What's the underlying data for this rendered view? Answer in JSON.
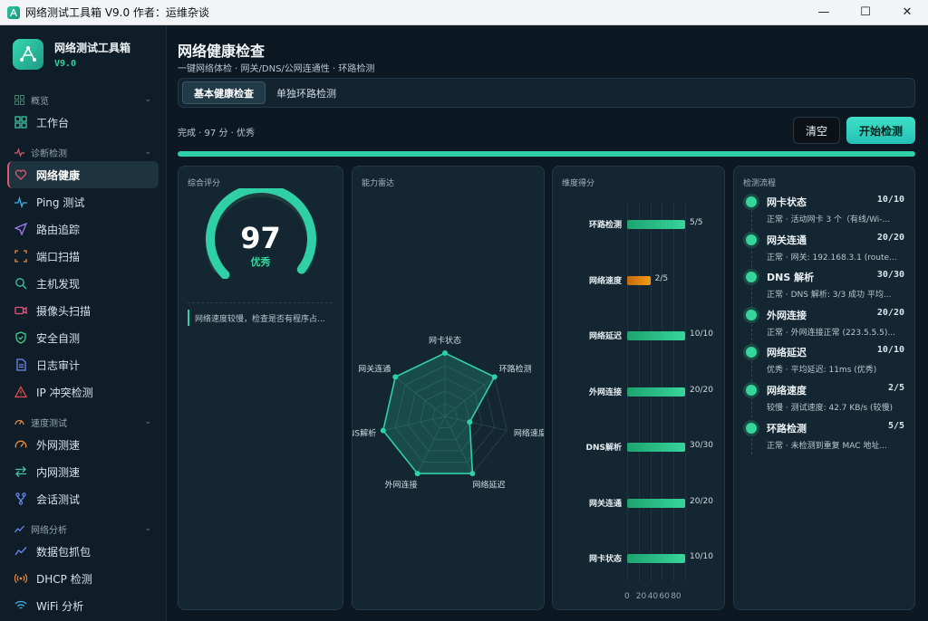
{
  "window": {
    "title": "网络测试工具箱 V9.0  作者：运维杂谈",
    "minimize": "—",
    "maximize": "☐",
    "close": "✕"
  },
  "brand": {
    "name": "网络测试工具箱",
    "version": "V9.0"
  },
  "sidebar": {
    "groups": [
      {
        "label": "概览",
        "items": [
          {
            "label": "工作台",
            "icon": "grid-icon"
          }
        ]
      },
      {
        "label": "诊断检测",
        "items": [
          {
            "label": "网络健康",
            "icon": "heart-icon",
            "active": true
          },
          {
            "label": "Ping 测试",
            "icon": "pulse-icon"
          },
          {
            "label": "路由追踪",
            "icon": "send-icon"
          },
          {
            "label": "端口扫描",
            "icon": "scan-icon"
          },
          {
            "label": "主机发现",
            "icon": "search-icon"
          },
          {
            "label": "摄像头扫描",
            "icon": "camera-icon"
          },
          {
            "label": "安全自测",
            "icon": "shield-icon"
          },
          {
            "label": "日志审计",
            "icon": "document-icon"
          },
          {
            "label": "IP 冲突检测",
            "icon": "warning-icon"
          }
        ]
      },
      {
        "label": "速度测试",
        "items": [
          {
            "label": "外网测速",
            "icon": "speedometer-icon"
          },
          {
            "label": "内网测速",
            "icon": "transfer-icon"
          },
          {
            "label": "会话测试",
            "icon": "fork-icon"
          }
        ]
      },
      {
        "label": "网络分析",
        "items": [
          {
            "label": "数据包抓包",
            "icon": "chart-line-icon"
          },
          {
            "label": "DHCP 检测",
            "icon": "broadcast-icon"
          },
          {
            "label": "WiFi 分析",
            "icon": "wifi-icon"
          }
        ]
      }
    ]
  },
  "page": {
    "title": "网络健康检查",
    "subtitle": "一键网络体检 · 网关/DNS/公网连通性 · 环路检测",
    "tabs": [
      "基本健康检查",
      "单独环路检测"
    ],
    "status": "完成 · 97 分 · 优秀",
    "clear_button": "清空",
    "start_button": "开始检测",
    "progress": 1.0
  },
  "score_card": {
    "title": "综合评分",
    "score": 97,
    "max": 100,
    "grade": "优秀",
    "tip": "网络速度较慢，检查是否有程序占..."
  },
  "radar_card": {
    "title": "能力雷达",
    "labels": [
      "网卡状态",
      "环路检测",
      "网络速度",
      "网络延迟",
      "外网连接",
      "DNS解析",
      "网关连通"
    ]
  },
  "dim_card": {
    "title": "维度得分",
    "axis_ticks": [
      "0",
      "20",
      "40",
      "60",
      "80"
    ]
  },
  "flow_card": {
    "title": "检测流程",
    "steps": [
      {
        "name": "网卡状态",
        "score": "10/10",
        "desc": "正常 · 活动网卡 3 个（有线/Wi-..."
      },
      {
        "name": "网关连通",
        "score": "20/20",
        "desc": "正常 · 网关: 192.168.3.1 (route..."
      },
      {
        "name": "DNS 解析",
        "score": "30/30",
        "desc": "正常 · DNS 解析: 3/3 成功 平均..."
      },
      {
        "name": "外网连接",
        "score": "20/20",
        "desc": "正常 · 外网连接正常 (223.5.5.5)..."
      },
      {
        "name": "网络延迟",
        "score": "10/10",
        "desc": "优秀 · 平均延迟: 11ms (优秀)"
      },
      {
        "name": "网络速度",
        "score": "2/5",
        "desc": "较慢 · 测试速度: 42.7 KB/s (较慢)"
      },
      {
        "name": "环路检测",
        "score": "5/5",
        "desc": "正常 · 未检测到重复 MAC 地址..."
      }
    ]
  },
  "chart_data": [
    {
      "type": "bar",
      "title": "维度得分",
      "orientation": "horizontal",
      "categories": [
        "环路检测",
        "网络速度",
        "网络延迟",
        "外网连接",
        "DNS解析",
        "网关连通",
        "网卡状态"
      ],
      "values": [
        5,
        2,
        10,
        20,
        30,
        20,
        10
      ],
      "max_values": [
        5,
        5,
        10,
        20,
        30,
        20,
        10
      ],
      "labels": [
        "5/5",
        "2/5",
        "10/10",
        "20/20",
        "30/30",
        "20/20",
        "10/10"
      ],
      "colors": {
        "normal": "#2fd0a6",
        "warn": "#f39c12"
      }
    },
    {
      "type": "radar",
      "title": "能力雷达",
      "axes": [
        "网卡状态",
        "环路检测",
        "网络速度",
        "网络延迟",
        "外网连接",
        "DNS解析",
        "网关连通"
      ],
      "values": [
        1.0,
        1.0,
        0.4,
        1.0,
        1.0,
        1.0,
        1.0
      ]
    }
  ],
  "colors": {
    "accent": "#2fd0a6",
    "warn": "#f39c12",
    "active_marker": "#e4556a"
  }
}
